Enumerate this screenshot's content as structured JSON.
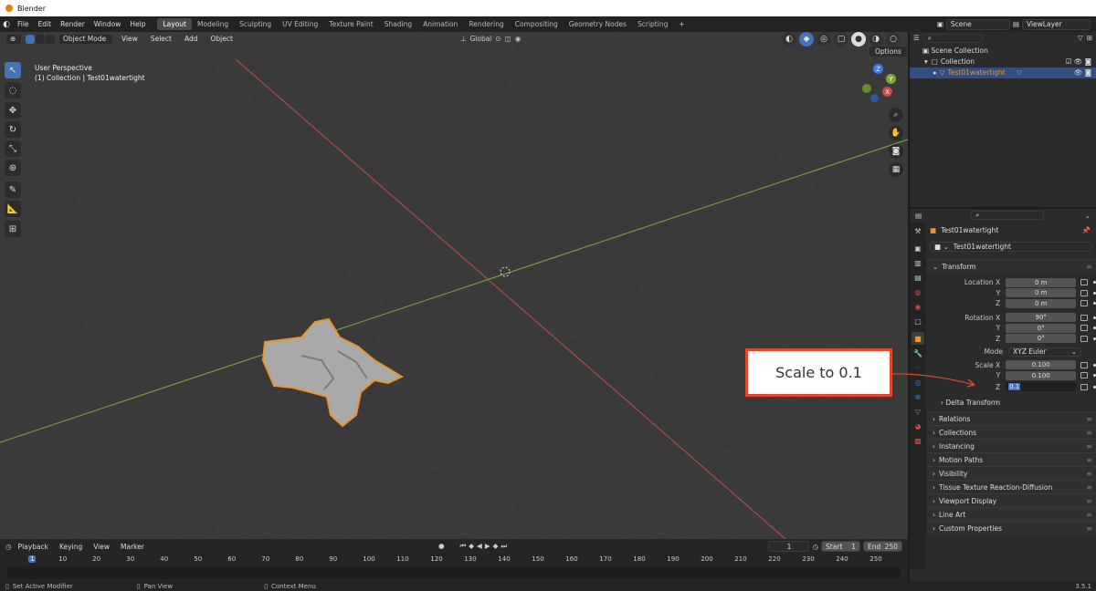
{
  "app": {
    "title": "Blender",
    "version": "3.5.1"
  },
  "menu": [
    "File",
    "Edit",
    "Render",
    "Window",
    "Help"
  ],
  "workspaces": [
    "Layout",
    "Modeling",
    "Sculpting",
    "UV Editing",
    "Texture Paint",
    "Shading",
    "Animation",
    "Rendering",
    "Compositing",
    "Geometry Nodes",
    "Scripting",
    "+"
  ],
  "scene": {
    "name": "Scene",
    "view_layer": "ViewLayer"
  },
  "viewport": {
    "mode": "Object Mode",
    "menu": [
      "View",
      "Select",
      "Add",
      "Object"
    ],
    "orientation": "Global",
    "options_label": "Options",
    "info_line1": "User Perspective",
    "info_line2": "(1) Collection | Test01watertight",
    "gizmo_axes": {
      "z": "Z",
      "y": "Y",
      "x": "X"
    }
  },
  "outliner": {
    "items": [
      {
        "label": "Scene Collection"
      },
      {
        "label": "Collection"
      },
      {
        "label": "Test01watertight"
      }
    ]
  },
  "properties": {
    "object_name": "Test01watertight",
    "object_datablock": "Test01watertight",
    "transform": {
      "title": "Transform",
      "location_label": "Location X",
      "location": [
        "0 m",
        "0 m",
        "0 m"
      ],
      "rotation_label": "Rotation X",
      "rotation": [
        "90°",
        "0°",
        "0°"
      ],
      "mode_label": "Mode",
      "mode_value": "XYZ Euler",
      "scale_label": "Scale X",
      "scale": [
        "0.100",
        "0.100",
        "0.1"
      ],
      "axis_y": "Y",
      "axis_z": "Z",
      "delta": "Delta Transform"
    },
    "panels": [
      "Relations",
      "Collections",
      "Instancing",
      "Motion Paths",
      "Visibility",
      "Tissue Texture Reaction-Diffusion",
      "Viewport Display",
      "Line Art",
      "Custom Properties"
    ]
  },
  "timeline": {
    "menu": [
      "Playback",
      "Keying",
      "View",
      "Marker"
    ],
    "current_frame": "1",
    "start_label": "Start",
    "start_value": "1",
    "end_label": "End",
    "end_value": "250",
    "ruler": [
      "1",
      "10",
      "20",
      "30",
      "40",
      "50",
      "60",
      "70",
      "80",
      "90",
      "100",
      "110",
      "120",
      "130",
      "140",
      "150",
      "160",
      "170",
      "180",
      "190",
      "200",
      "210",
      "220",
      "230",
      "240",
      "250"
    ]
  },
  "statusbar": {
    "hint1": "Set Active Modifier",
    "hint2": "Pan View",
    "hint3": "Context Menu"
  },
  "annotation": {
    "text": "Scale to 0.1"
  },
  "colors": {
    "accent": "#4772b3",
    "selection_outline": "#e8952c",
    "callout_border": "#e04a2a",
    "x_axis": "#c84b4b",
    "y_axis": "#7fa83c"
  }
}
